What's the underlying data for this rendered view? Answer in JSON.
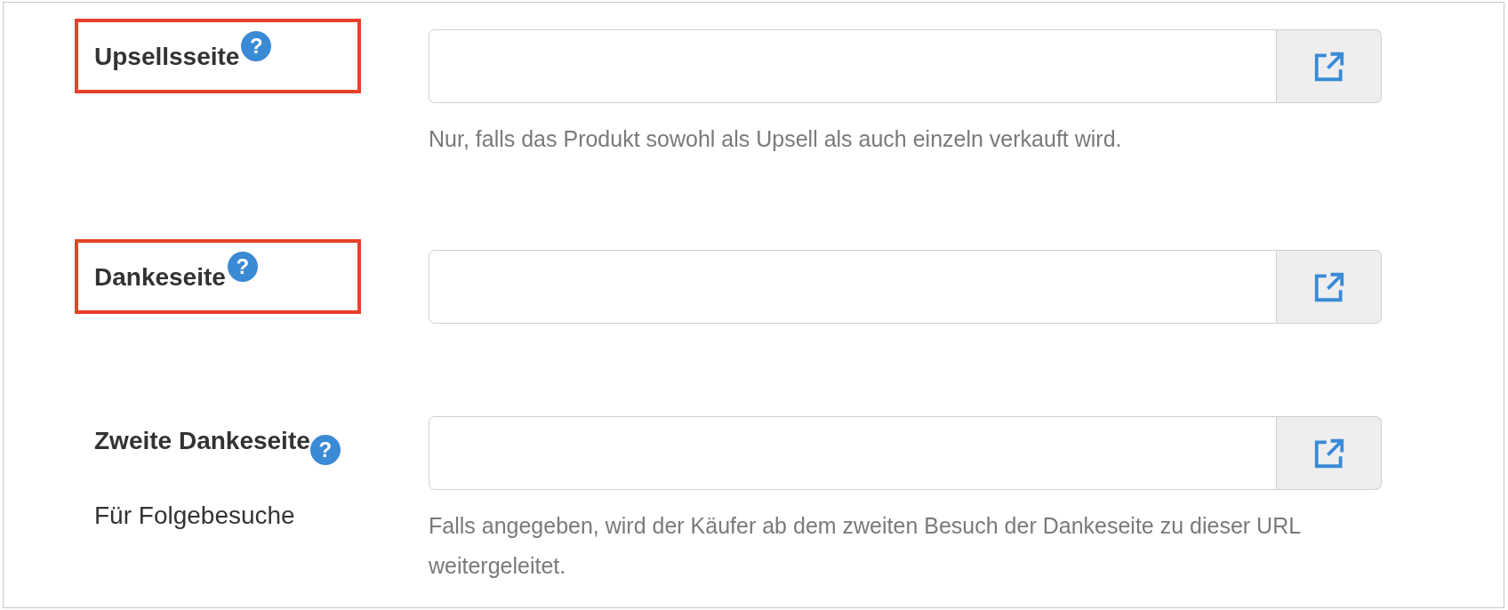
{
  "rows": [
    {
      "label": "Upsellsseite",
      "help": "?",
      "highlighted": true,
      "value": "",
      "hint": "Nur, falls das Produkt sowohl als Upsell als auch einzeln verkauft wird."
    },
    {
      "label": "Dankeseite",
      "help": "?",
      "highlighted": true,
      "value": ""
    },
    {
      "label": "Zweite Dankeseite",
      "help": "?",
      "highlighted": false,
      "sublabel": "Für Folgebesuche",
      "value": "",
      "hint": "Falls angegeben, wird der Käufer ab dem zweiten Besuch der Dankeseite zu dieser URL weitergeleitet."
    }
  ]
}
